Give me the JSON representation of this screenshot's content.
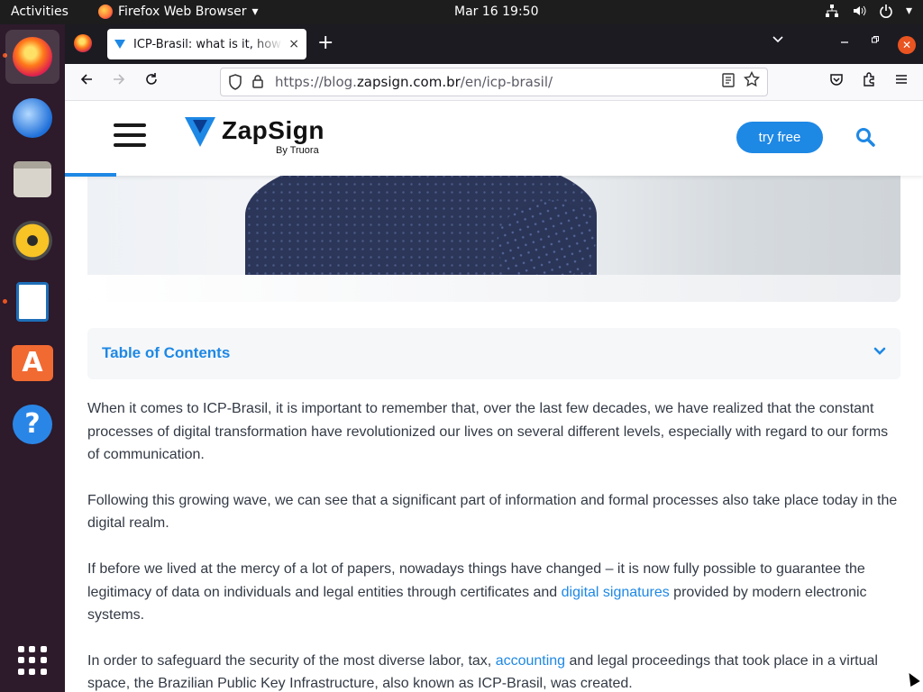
{
  "system_bar": {
    "activities_label": "Activities",
    "app_menu_label": "Firefox Web Browser",
    "clock": "Mar 16  19:50"
  },
  "dock": {
    "items": [
      "firefox-icon",
      "thunderbird-icon",
      "files-icon",
      "rhythmbox-icon",
      "libreoffice-writer-icon",
      "software-store-icon",
      "help-icon"
    ],
    "show_apps": "app-grid-icon"
  },
  "browser": {
    "tab_title": "ICP-Brasil: what is it, how",
    "tab_close_glyph": "×",
    "new_tab_glyph": "+",
    "url_scheme": "https://blog.",
    "url_domain": "zapsign.com.br",
    "url_path": "/en/icp-brasil/"
  },
  "site": {
    "logo_text": "ZapSign",
    "logo_sub": "By Truora",
    "cta_label": "try free",
    "reading_progress": 0.06,
    "accent_color": "#1e88e5"
  },
  "toc": {
    "title": "Table of Contents"
  },
  "article": {
    "p1": "When it comes to ICP-Brasil, it is important to remember that, over the last few decades, we have realized that the constant processes of digital transformation have revolutionized our lives on several different levels, especially with regard to our forms of communication.",
    "p2": "Following this growing wave, we can see that a significant part of information and formal processes also take place today in the digital realm.",
    "p3_before": "If before we lived at the mercy of a lot of papers, nowadays things have changed – it is now fully possible to guarantee the legitimacy of data on individuals and legal entities through certificates and ",
    "p3_link": "digital signatures",
    "p3_after": " provided by modern electronic systems.",
    "p4_before": "In order to safeguard the security of the most diverse labor, tax, ",
    "p4_link": "accounting",
    "p4_after": " and legal proceedings that took place in a virtual space, the Brazilian Public Key Infrastructure, also known as ICP-Brasil, was created."
  }
}
